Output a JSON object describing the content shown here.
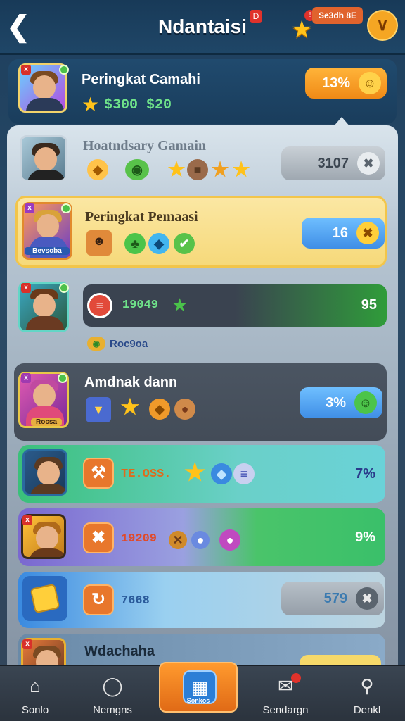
{
  "header": {
    "title": "Ndantaisi",
    "title_badge": "D",
    "currency_pill": "Se3dh 8E",
    "currency_badge": "!",
    "back_icon": "back-arrow-icon",
    "menu_icon": "check-down-icon"
  },
  "rows": [
    {
      "name": "Peringkat Camahi",
      "score": "$300  $20",
      "chip": "13%",
      "chip_icon": "smile-coin-icon"
    },
    {
      "name": "Hoatndsary Gamain",
      "chip": "3107",
      "chip_icon": "wrench-icon"
    },
    {
      "name": "Peringkat Pemaasi",
      "avatar_label": "Bevsoba",
      "chip": "16",
      "chip_icon": "x-coin-icon"
    },
    {
      "score": "19049",
      "bar_value": "95",
      "sub_label": "Roc9oa"
    },
    {
      "name": "Amdnak dann",
      "avatar_label": "Rocsa",
      "chip": "3%",
      "chip_icon": "frog-icon"
    },
    {
      "score": "TE.OSS.",
      "bar_value": "7%"
    },
    {
      "score": "19209",
      "bar_value": "9%"
    },
    {
      "score": "7668",
      "chip": "579"
    },
    {
      "name": "Wdachaha"
    }
  ],
  "nav": {
    "items": [
      {
        "label": "Sonlo",
        "icon": "home-icon"
      },
      {
        "label": "Nemgns",
        "icon": "shield-check-icon"
      },
      {
        "label": "Sonkos",
        "icon": "map-icon"
      },
      {
        "label": "Sendargn",
        "icon": "mail-icon"
      },
      {
        "label": "Denkl",
        "icon": "search-icon"
      }
    ]
  }
}
